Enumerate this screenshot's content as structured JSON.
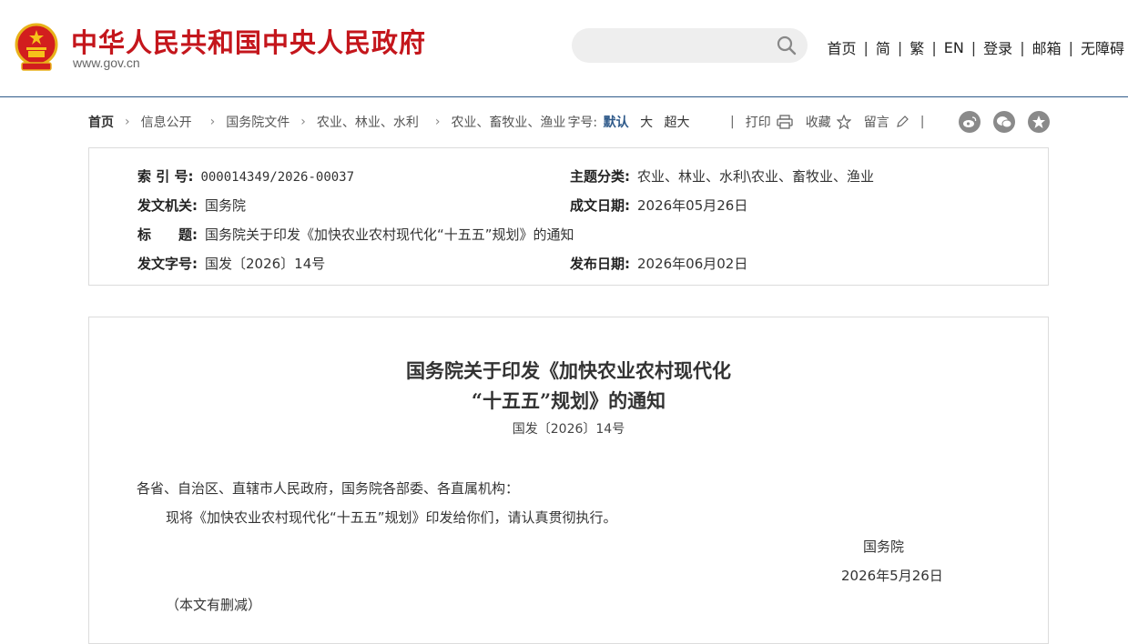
{
  "header": {
    "site_title": "中华人民共和国中央人民政府",
    "site_url": "www.gov.cn",
    "search": {
      "placeholder": ""
    },
    "nav": [
      "首页",
      "简",
      "繁",
      "EN",
      "登录",
      "邮箱",
      "无障碍"
    ]
  },
  "breadcrumb": {
    "items": [
      "首页",
      "信息公开",
      "国务院文件",
      "农业、林业、水利",
      "农业、畜牧业、渔业"
    ],
    "font_size_label": "字号:",
    "font_sizes": [
      "默认",
      "大",
      "超大"
    ],
    "active_font_size": "默认"
  },
  "tools": {
    "print": "打印",
    "favorite": "收藏",
    "comment": "留言",
    "share_icons": [
      "weibo-icon",
      "wechat-icon",
      "favorites-star-icon"
    ]
  },
  "meta": {
    "index_label": "索 引 号:",
    "index_value": "000014349/2026-00037",
    "topic_label": "主题分类:",
    "topic_value": "农业、林业、水利\\农业、畜牧业、渔业",
    "issuer_label": "发文机关:",
    "issuer_value": "国务院",
    "date_written_label": "成文日期:",
    "date_written_value": "2026年05月26日",
    "title_label": "标　　题:",
    "title_value": "国务院关于印发《加快农业农村现代化“十五五”规划》的通知",
    "doc_no_label": "发文字号:",
    "doc_no_value": "国发〔2026〕14号",
    "publish_date_label": "发布日期:",
    "publish_date_value": "2026年06月02日"
  },
  "document": {
    "title_line1": "国务院关于印发《加快农业农村现代化",
    "title_line2": "“十五五”规划》的通知",
    "doc_no": "国发〔2026〕14号",
    "salutation": "各省、自治区、直辖市人民政府，国务院各部委、各直属机构：",
    "body": "现将《加快农业农村现代化“十五五”规划》印发给你们，请认真贯彻执行。",
    "signature": "国务院",
    "date": "2026年5月26日",
    "note": "（本文有删减）"
  },
  "colors": {
    "brand_red": "#c4161c",
    "header_rule": "#2f5a8a",
    "active_font": "#2f5a8a"
  }
}
